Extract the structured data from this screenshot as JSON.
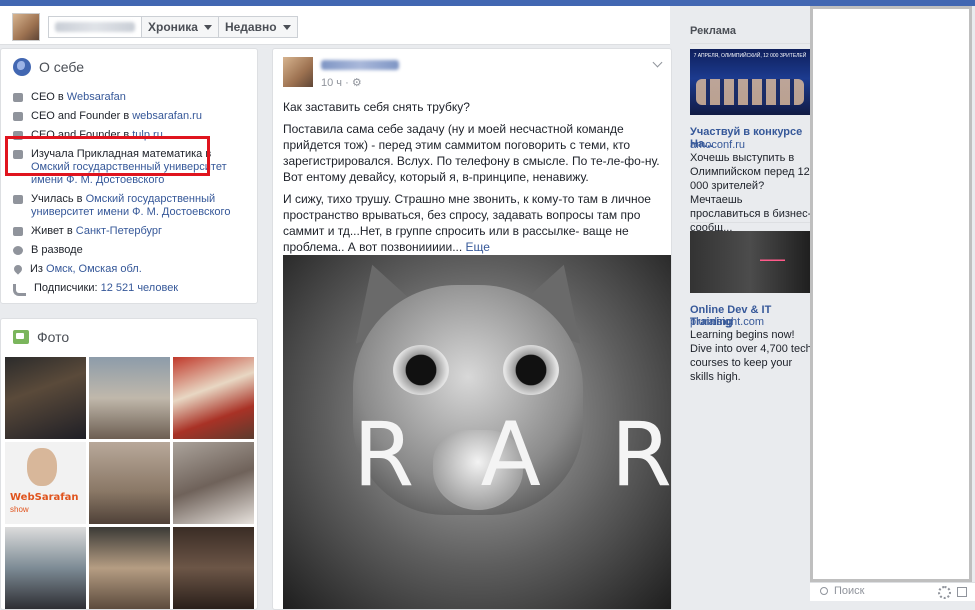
{
  "header": {
    "crumbs": [
      {
        "label": "Хроника"
      },
      {
        "label": "Недавно"
      }
    ]
  },
  "about": {
    "title": "О себе",
    "rows": [
      {
        "prefix": "CEO в ",
        "link": "Websarafan",
        "icon": "briefcase-icon"
      },
      {
        "prefix": "CEO and Founder в ",
        "link": "websarafan.ru",
        "icon": "briefcase-icon"
      },
      {
        "prefix": "CEO and Founder в ",
        "link": "tulp.ru",
        "icon": "briefcase-icon"
      },
      {
        "prefix": "Изучала Прикладная математика в ",
        "link": "Омский государственный университет имени Ф. М. Достоевского",
        "icon": "graduation-cap-icon"
      },
      {
        "prefix": "Училась в ",
        "link": "Омский государственный университет имени Ф. М. Достоевского",
        "icon": "graduation-cap-icon"
      },
      {
        "prefix": "Живет в ",
        "link": "Санкт-Петербург",
        "icon": "home-icon"
      },
      {
        "prefix": "В разводе",
        "link": "",
        "icon": "heart-icon"
      },
      {
        "prefix": "Из ",
        "link": "Омск, Омская обл.",
        "icon": "location-pin-icon"
      },
      {
        "prefix": "Подписчики: ",
        "link": "12 521 человек",
        "icon": "rss-icon"
      }
    ]
  },
  "photos": {
    "title": "Фото",
    "ws_logo": "WebSarafan",
    "ws_sub": "show"
  },
  "post": {
    "time": "10 ч · ",
    "paragraphs": [
      "Как заставить себя снять трубку?",
      "Поставила сама себе задачу (ну и моей несчастной команде прийдется тож) - перед этим саммитом поговорить с теми, кто зарегистрировался. Вслух. По телефону в смысле. По те-ле-фо-ну. Вот ентому девайсу, который я, в-принципе, ненавижу.",
      "И сижу, тихо трушу. Страшно мне звонить, к кому-то там в личное пространство врываться, без спросу, задавать вопросы там про саммит и тд...Нет, в группе спросить или в рассылке- ваще не проблема.. А вот позвониииии... "
    ],
    "more": "Еще",
    "image_text": "RAR"
  },
  "ads": {
    "title": "Реклама",
    "items": [
      {
        "headline": "Участвуй в конкурсе На...",
        "domain": "amoconf.ru",
        "text": "Хочешь выступить в Олимпийском перед 12 000 зрителей? Мечтаешь прославиться в бизнес-сообщ...",
        "image_header": "7 АПРЕЛЯ, ОЛИМПИЙСКИЙ, 12 000 ЗРИТЕЛЕЙ"
      },
      {
        "headline": "Online Dev & IT Training",
        "domain": "pluralsight.com",
        "text": "Learning begins now! Dive into over 4,700 tech courses to keep your skills high."
      }
    ]
  },
  "chat": {
    "search_placeholder": "Поиск"
  }
}
